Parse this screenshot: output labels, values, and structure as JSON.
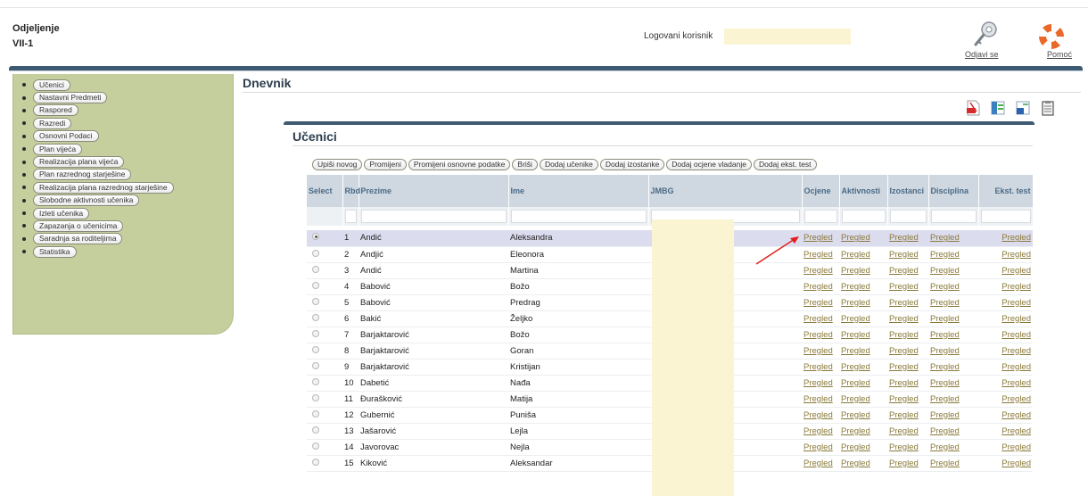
{
  "header": {
    "dept_label": "Odjeljenje",
    "dept_value": "VII-1",
    "user_label": "Logovani korisnik",
    "logout_label": "Odjavi se",
    "help_label": "Pomoć"
  },
  "sidebar": {
    "items": [
      {
        "label": "Učenici"
      },
      {
        "label": "Nastavni Predmeti"
      },
      {
        "label": "Raspored"
      },
      {
        "label": "Razredi"
      },
      {
        "label": "Osnovni Podaci"
      },
      {
        "label": "Plan vijeća"
      },
      {
        "label": "Realizacija plana vijeća"
      },
      {
        "label": "Plan razrednog starješine"
      },
      {
        "label": "Realizacija plana razrednog starješine"
      },
      {
        "label": "Slobodne aktivnosti učenika"
      },
      {
        "label": "Izleti učenika"
      },
      {
        "label": "Zapazanja o učenicima"
      },
      {
        "label": "Saradnja sa roditeljima"
      },
      {
        "label": "Statistika"
      }
    ]
  },
  "main": {
    "title": "Dnevnik",
    "panel_title": "Učenici",
    "export_icons": [
      "pdf-icon",
      "excel-icon",
      "word-icon",
      "clipboard-icon"
    ],
    "toolbar": [
      "Upiši novog",
      "Promijeni",
      "Promijeni osnovne podatke",
      "Briši",
      "Dodaj učenike",
      "Dodaj izostanke",
      "Dodaj ocjene vladanje",
      "Dodaj ekst. test"
    ],
    "table": {
      "columns": [
        "Select",
        "Rbd",
        "Prezime",
        "Ime",
        "JMBG",
        "Ocjene",
        "Aktivnosti",
        "Izostanci",
        "Disciplina",
        "Ekst. test"
      ],
      "link_label": "Pregled",
      "selected_index": 0,
      "rows": [
        {
          "rbd": "1",
          "prezime": "Andić",
          "ime": "Aleksandra"
        },
        {
          "rbd": "2",
          "prezime": "Andjić",
          "ime": "Eleonora"
        },
        {
          "rbd": "3",
          "prezime": "Andić",
          "ime": "Martina"
        },
        {
          "rbd": "4",
          "prezime": "Babović",
          "ime": "Božo"
        },
        {
          "rbd": "5",
          "prezime": "Babović",
          "ime": "Predrag"
        },
        {
          "rbd": "6",
          "prezime": "Bakić",
          "ime": "Željko"
        },
        {
          "rbd": "7",
          "prezime": "Barjaktarović",
          "ime": "Božo"
        },
        {
          "rbd": "8",
          "prezime": "Barjaktarović",
          "ime": "Goran"
        },
        {
          "rbd": "9",
          "prezime": "Barjaktarović",
          "ime": "Kristijan"
        },
        {
          "rbd": "10",
          "prezime": "Dabetić",
          "ime": "Nađa"
        },
        {
          "rbd": "11",
          "prezime": "Đurašković",
          "ime": "Matija"
        },
        {
          "rbd": "12",
          "prezime": "Gubernić",
          "ime": "Puniša"
        },
        {
          "rbd": "13",
          "prezime": "Jašarović",
          "ime": "Lejla"
        },
        {
          "rbd": "14",
          "prezime": "Javorovac",
          "ime": "Nejla"
        },
        {
          "rbd": "15",
          "prezime": "Kiković",
          "ime": "Aleksandar"
        }
      ]
    }
  },
  "colors": {
    "accent_bar": "#3d5a72",
    "sidebar_bg": "#c5cf9e",
    "header_row": "#cfd8e1",
    "selected_row": "#dcdcef",
    "link": "#8a7a3a",
    "annotation_arrow": "#e02020"
  }
}
